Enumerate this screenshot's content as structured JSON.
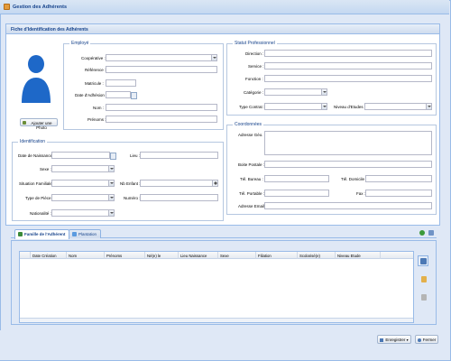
{
  "window": {
    "title": "Gestion des Adhérents"
  },
  "panel": {
    "title": "Fiche d'Identification des Adhérents"
  },
  "employe": {
    "legend": "Employé",
    "add_photo": "Ajouter une Photo",
    "fields": {
      "cooperative": "Coopérative :",
      "reference": "Référence :",
      "matricule": "Matricule :",
      "date_adhesion": "Date d'Adhésion :",
      "nom": "Nom :",
      "prenoms": "Prénoms :"
    }
  },
  "statut": {
    "legend": "Statut Professionnel",
    "fields": {
      "direction": "Direction :",
      "service": "Service :",
      "fonction": "Fonction :",
      "categorie": "Catégorie :",
      "type_contrat": "Type Contrat :",
      "niveau_etudes": "Niveau d'Etudes :"
    }
  },
  "identification": {
    "legend": "Identification",
    "fields": {
      "date_naissance": "Date de Naissance :",
      "lieu": "Lieu :",
      "sexe": "Sexe :",
      "situation_familiale": "Situation Familiale :",
      "nb_enfant": "Nb Enfant :",
      "type_piece": "Type de Pièce :",
      "numero": "Numéro :",
      "nationalite": "Nationalité :"
    }
  },
  "coordonnees": {
    "legend": "Coordonnées",
    "fields": {
      "adresse_geo": "Adresse Géo. :",
      "boite_postale": "Boite Postale :",
      "tel_bureau": "Tél. Bureau :",
      "tel_domicile": "Tél. Domicile :",
      "tel_portable": "Tél. Portable :",
      "fax": "Fax :",
      "adresse_email": "Adresse Email :"
    }
  },
  "tabs": [
    {
      "label": "Famille de l'Adhérent",
      "icon": "family-icon"
    },
    {
      "label": "Plantation",
      "icon": "plantation-icon"
    }
  ],
  "grid": {
    "columns": [
      "Date Création",
      "Nom",
      "Prénoms",
      "Né(e) le",
      "Lieu Naissance",
      "Sexe",
      "Filiation",
      "Scolarisé(e)",
      "Niveau Etude"
    ]
  },
  "footer": {
    "save_label": "Enregistrer",
    "close_label": "Fermer"
  },
  "colors": {
    "accent": "#15428b",
    "border": "#99bbe8",
    "bg": "#dfe8f6"
  }
}
